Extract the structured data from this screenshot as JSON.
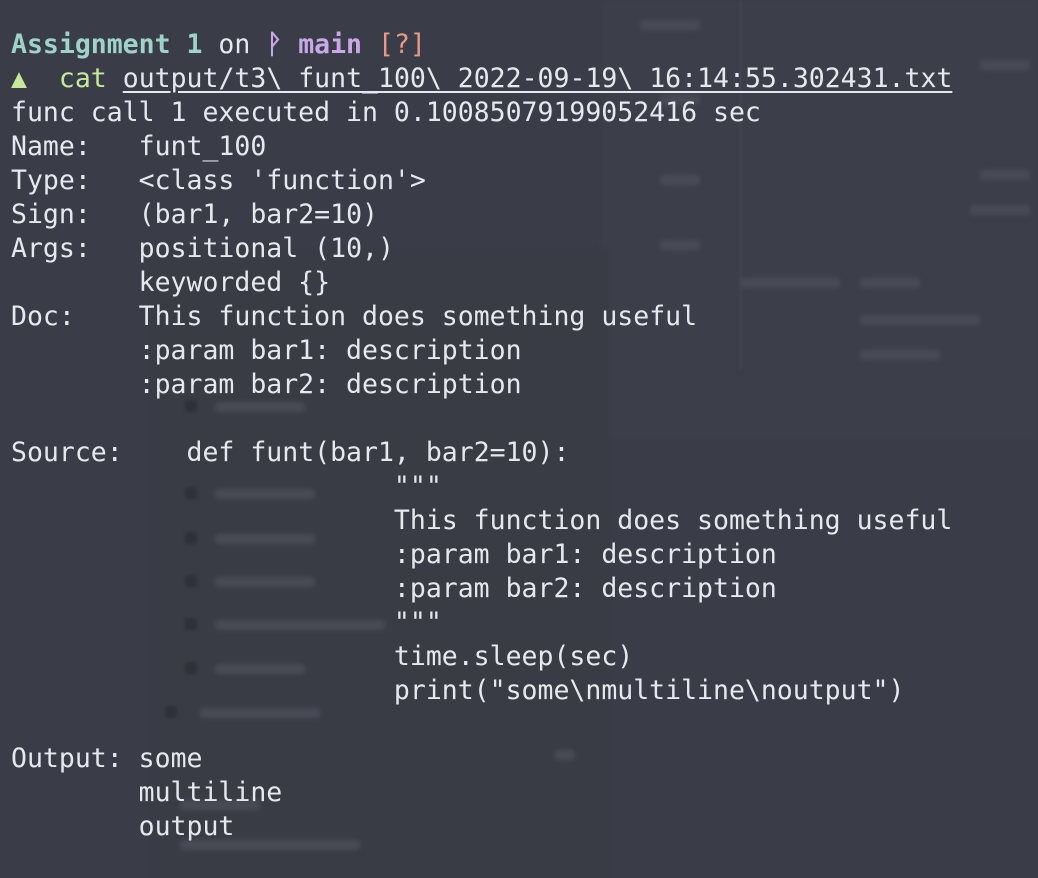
{
  "prompt": {
    "dir": "Assignment 1",
    "on": "on",
    "branch_icon": "ᚹ",
    "branch": "main",
    "status": "[?]"
  },
  "command": {
    "arrow": "▲",
    "name": "cat",
    "arg": "output/t3\\ funt_100\\ 2022-09-19\\ 16:14:55.302431.txt"
  },
  "output": {
    "exec_line": "func call 1 executed in 0.10085079199052416 sec",
    "name_label": "Name:",
    "name_value": "funt_100",
    "type_label": "Type:",
    "type_value": "<class 'function'>",
    "sign_label": "Sign:",
    "sign_value": "(bar1, bar2=10)",
    "args_label": "Args:",
    "args_positional": "positional (10,)",
    "args_keyworded": "keyworded {}",
    "doc_label": "Doc:",
    "doc_lines": [
      "This function does something useful",
      ":param bar1: description",
      ":param bar2: description"
    ],
    "source_label": "Source:",
    "source_def": "def funt(bar1, bar2=10):",
    "source_lines": [
      "\"\"\"",
      "This function does something useful",
      ":param bar1: description",
      ":param bar2: description",
      "\"\"\"",
      "time.sleep(sec)",
      "print(\"some\\nmultiline\\noutput\")"
    ],
    "output_label": "Output:",
    "output_lines": [
      "some",
      "multiline",
      "output"
    ]
  }
}
